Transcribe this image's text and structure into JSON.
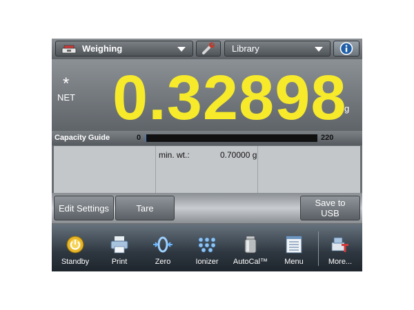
{
  "topbar": {
    "application": "Weighing",
    "library": "Library",
    "tools_icon": "wrench-icon",
    "info_icon": "info-icon"
  },
  "display": {
    "stable_indicator": "*",
    "mode": "NET",
    "value": "0.32898",
    "unit": "g"
  },
  "capacity_guide": {
    "label": "Capacity Guide",
    "min": "0",
    "max": "220",
    "level_fraction": 0.0015
  },
  "reference": {
    "label": "min. wt.:",
    "value": "0.70000 g"
  },
  "actions": {
    "edit_settings": "Edit Settings",
    "tare": "Tare",
    "save_usb_line1": "Save to",
    "save_usb_line2": "USB"
  },
  "nav": [
    {
      "label": "Standby",
      "icon": "standby-icon"
    },
    {
      "label": "Print",
      "icon": "printer-icon"
    },
    {
      "label": "Zero",
      "icon": "zero-icon"
    },
    {
      "label": "Ionizer",
      "icon": "ionizer-icon"
    },
    {
      "label": "AutoCal™",
      "icon": "autocal-weight-icon"
    },
    {
      "label": "Menu",
      "icon": "menu-icon"
    },
    {
      "label": "More...",
      "icon": "more-icon"
    }
  ]
}
